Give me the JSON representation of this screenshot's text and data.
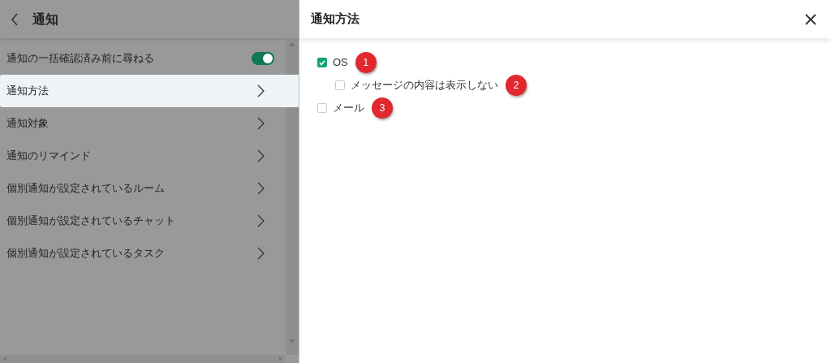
{
  "header": {
    "title": "通知"
  },
  "settings": [
    {
      "kind": "toggle",
      "label": "通知の一括確認済み前に尋ねる",
      "on": true,
      "selected": false
    },
    {
      "kind": "link",
      "label": "通知方法",
      "selected": true
    },
    {
      "kind": "link",
      "label": "通知対象",
      "selected": false
    },
    {
      "kind": "link",
      "label": "通知のリマインド",
      "selected": false
    },
    {
      "kind": "link",
      "label": "個別通知が設定されているルーム",
      "selected": false
    },
    {
      "kind": "link",
      "label": "個別通知が設定されているチャット",
      "selected": false
    },
    {
      "kind": "link",
      "label": "個別通知が設定されているタスク",
      "selected": false
    }
  ],
  "dialog": {
    "title": "通知方法",
    "options": [
      {
        "label": "OS",
        "checked": true,
        "badge": "1",
        "children": [
          {
            "label": "メッセージの内容は表示しない",
            "checked": false,
            "badge": "2"
          }
        ]
      },
      {
        "label": "メール",
        "checked": false,
        "badge": "3"
      }
    ]
  }
}
